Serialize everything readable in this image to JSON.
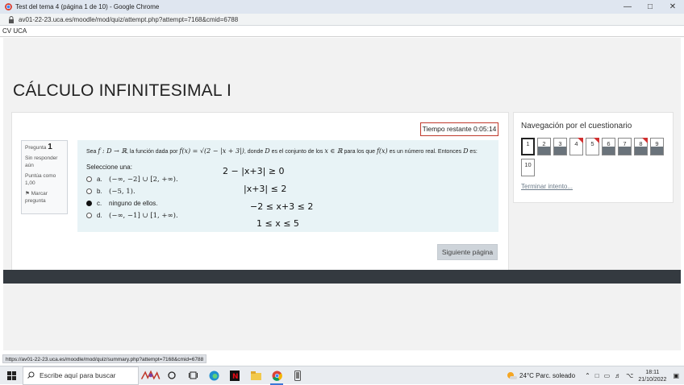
{
  "window": {
    "title": "Test del tema 4 (página 1 de 10) - Google Chrome",
    "url": "av01-22-23.uca.es/moodle/mod/quiz/attempt.php?attempt=7168&cmid=6788"
  },
  "site": {
    "name": "CV UCA"
  },
  "page": {
    "title": "CÁLCULO INFINITESIMAL I"
  },
  "timer": {
    "text": "Tiempo restante 0:05:14"
  },
  "question_info": {
    "label": "Pregunta",
    "number": "1",
    "status": "Sin responder aún",
    "score_label": "Puntúa como",
    "score_value": "1,00",
    "flag_label": "Marcar pregunta"
  },
  "question": {
    "text_parts": {
      "p1": "Sea ",
      "m1": "f : D → ℝ",
      "p2": ", la función dada por ",
      "m2": "f(x) = √(2 − |x + 3|)",
      "p3": ", donde ",
      "m3": "D",
      "p4": " es el conjunto de los ",
      "m4": "x ∈ ℝ",
      "p5": " para los que ",
      "m5": "f(x)",
      "p6": " es un número real. Entonces ",
      "m6": "D",
      "p7": " es:"
    },
    "prompt": "Seleccione una:",
    "answers": [
      {
        "letter": "a.",
        "text": "(−∞, −2] ∪ [2, +∞).",
        "checked": false
      },
      {
        "letter": "b.",
        "text": "(−5, 1).",
        "checked": false
      },
      {
        "letter": "c.",
        "text": "ninguno de ellos.",
        "checked": true
      },
      {
        "letter": "d.",
        "text": "(−∞, −1] ∪ [1, +∞).",
        "checked": false
      }
    ],
    "handwriting": [
      "2 − |x+3| ≥ 0",
      "|x+3| ≤ 2",
      "−2 ≤ x+3 ≤ 2",
      "1 ≤ x ≤ 5"
    ]
  },
  "buttons": {
    "next": "Siguiente página"
  },
  "navigation": {
    "title": "Navegación por el cuestionario",
    "questions": [
      {
        "n": "1",
        "current": true,
        "answered": false,
        "flagged": false
      },
      {
        "n": "2",
        "current": false,
        "answered": true,
        "flagged": false
      },
      {
        "n": "3",
        "current": false,
        "answered": true,
        "flagged": false
      },
      {
        "n": "4",
        "current": false,
        "answered": false,
        "flagged": true
      },
      {
        "n": "5",
        "current": false,
        "answered": false,
        "flagged": true
      },
      {
        "n": "6",
        "current": false,
        "answered": true,
        "flagged": false
      },
      {
        "n": "7",
        "current": false,
        "answered": true,
        "flagged": false
      },
      {
        "n": "8",
        "current": false,
        "answered": true,
        "flagged": true
      },
      {
        "n": "9",
        "current": false,
        "answered": true,
        "flagged": false
      },
      {
        "n": "10",
        "current": false,
        "answered": false,
        "flagged": false
      }
    ],
    "finish": "Terminar intento..."
  },
  "status_bar": {
    "url": "https://av01-22-23.uca.es/moodle/mod/quiz/summary.php?attempt=7168&cmid=6788"
  },
  "taskbar": {
    "search_placeholder": "Escribe aquí para buscar",
    "weather": "24°C  Parc. soleado",
    "time": "18:11",
    "date": "21/10/2022"
  },
  "colors": {
    "accent": "#0f6cbf",
    "timer_border": "#c0392b",
    "footer": "#343a40",
    "question_bg": "#e8f3f6"
  }
}
